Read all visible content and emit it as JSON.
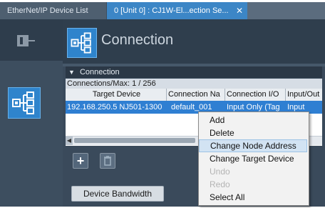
{
  "tabs": [
    {
      "label": "EtherNet/IP Device List"
    },
    {
      "label": "0 [Unit 0] : CJ1W-El...ection Se..."
    }
  ],
  "tab_close_glyph": "✕",
  "header": {
    "title": "Connection"
  },
  "section": {
    "label": "Connection",
    "toggle_glyph": "▼"
  },
  "connections_count": "Connections/Max: 1 / 256",
  "table": {
    "columns": [
      "Target Device",
      "Connection Na",
      "Connection I/O",
      "Input/Out"
    ],
    "rows": [
      [
        "192.168.250.5 NJ501-1300",
        "default_001",
        "Input Only (Tag",
        "Input"
      ]
    ]
  },
  "buttons": {
    "add_glyph": "+",
    "device_bandwidth": "Device Bandwidth"
  },
  "context_menu": [
    {
      "label": "Add",
      "enabled": true,
      "highlighted": false
    },
    {
      "label": "Delete",
      "enabled": true,
      "highlighted": false
    },
    {
      "label": "Change Node Address",
      "enabled": true,
      "highlighted": true
    },
    {
      "label": "Change Target Device",
      "enabled": true,
      "highlighted": false
    },
    {
      "label": "Undo",
      "enabled": false,
      "highlighted": false
    },
    {
      "label": "Redo",
      "enabled": false,
      "highlighted": false
    },
    {
      "label": "Select All",
      "enabled": true,
      "highlighted": false
    }
  ],
  "colors": {
    "accent": "#2f84cc",
    "selected_row": "#2f7fd2",
    "dark_panel": "#2f3e4d"
  }
}
